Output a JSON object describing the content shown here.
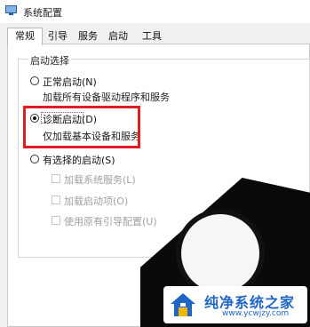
{
  "window": {
    "title": "系统配置"
  },
  "tabs": [
    "常规",
    "引导",
    "服务",
    "启动",
    "工具"
  ],
  "startup_group": {
    "legend": "启动选择",
    "normal": {
      "label": "正常启动(N)",
      "description": "加载所有设备驱动程序和服务"
    },
    "diagnostic": {
      "label": "诊断启动(D)",
      "description": "仅加载基本设备和服务",
      "selected": true
    },
    "selective": {
      "label": "有选择的启动(S)",
      "options": [
        "加载系统服务(L)",
        "加载启动项(O)",
        "使用原有引导配置(U)"
      ]
    }
  },
  "highlight_color": "#e11c24",
  "watermark": {
    "title": "纯净系统之家",
    "url": "www.ycwjzy.com"
  }
}
